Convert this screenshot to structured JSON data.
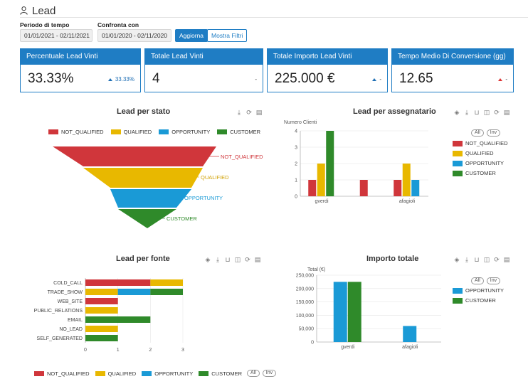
{
  "page": {
    "title": "Lead",
    "icon": "user-icon"
  },
  "filters": {
    "period_label": "Periodo di tempo",
    "period_value": "01/01/2021 - 02/11/2021",
    "compare_label": "Confronta con",
    "compare_value": "01/01/2020 - 02/11/2020",
    "refresh_button": "Aggiorna",
    "filters_button": "Mostra Filtri"
  },
  "kpis": [
    {
      "title": "Percentuale Lead Vinti",
      "value": "33.33%",
      "trend": "33.33%",
      "trend_dir": "up"
    },
    {
      "title": "Totale Lead Vinti",
      "value": "4",
      "trend": "-",
      "trend_dir": "none"
    },
    {
      "title": "Totale Importo Lead Vinti",
      "value": "225.000 €",
      "trend": "-",
      "trend_dir": "up"
    },
    {
      "title": "Tempo Medio Di Conversione (gg)",
      "value": "12.65",
      "trend": "-",
      "trend_dir": "up-red"
    }
  ],
  "colors": {
    "primary": "#1f7dc4",
    "not_qualified": "#d0363b",
    "qualified": "#e8b800",
    "opportunity": "#1a9ad6",
    "customer": "#2f8a2a"
  },
  "legend_labels": {
    "not_qualified": "NOT_QUALIFIED",
    "qualified": "QUALIFIED",
    "opportunity": "OPPORTUNITY",
    "customer": "CUSTOMER",
    "all": "All",
    "inv": "Inv"
  },
  "chart_data": [
    {
      "id": "lead-per-stato",
      "type": "funnel",
      "title": "Lead per stato",
      "categories": [
        "NOT_QUALIFIED",
        "QUALIFIED",
        "OPPORTUNITY",
        "CUSTOMER"
      ],
      "legend": "top"
    },
    {
      "id": "lead-per-assegnatario",
      "type": "bar",
      "title": "Lead per assegnatario",
      "ylabel": "Numero Clienti",
      "categories": [
        "gverdi",
        "",
        "afagioli"
      ],
      "series": [
        {
          "name": "NOT_QUALIFIED",
          "values": [
            1,
            1,
            1
          ]
        },
        {
          "name": "QUALIFIED",
          "values": [
            2,
            0,
            2
          ]
        },
        {
          "name": "OPPORTUNITY",
          "values": [
            0,
            0,
            1
          ]
        },
        {
          "name": "CUSTOMER",
          "values": [
            4,
            0,
            0
          ]
        }
      ],
      "yticks": [
        0,
        1,
        2,
        3,
        4
      ],
      "ylim": [
        0,
        4
      ],
      "legend": "right"
    },
    {
      "id": "lead-per-fonte",
      "type": "stacked-bar-horizontal",
      "title": "Lead per fonte",
      "categories": [
        "COLD_CALL",
        "TRADE_SHOW",
        "WEB_SITE",
        "PUBLIC_RELATIONS",
        "EMAIL",
        "NO_LEAD",
        "SELF_GENERATED"
      ],
      "series": [
        {
          "name": "NOT_QUALIFIED",
          "values": [
            2,
            0,
            1,
            0,
            0,
            0,
            0
          ]
        },
        {
          "name": "QUALIFIED",
          "values": [
            1,
            1,
            0,
            1,
            0,
            1,
            0
          ]
        },
        {
          "name": "OPPORTUNITY",
          "values": [
            0,
            1,
            0,
            0,
            0,
            0,
            0
          ]
        },
        {
          "name": "CUSTOMER",
          "values": [
            0,
            1,
            0,
            0,
            2,
            0,
            1
          ]
        }
      ],
      "xticks": [
        0,
        1,
        2,
        3
      ],
      "xlim": [
        0,
        3
      ],
      "legend": "bottom"
    },
    {
      "id": "importo-totale",
      "type": "bar",
      "title": "Importo totale",
      "ylabel": "Total (€)",
      "categories": [
        "gverdi",
        "afagioli"
      ],
      "series": [
        {
          "name": "OPPORTUNITY",
          "values": [
            225000,
            60000
          ]
        },
        {
          "name": "CUSTOMER",
          "values": [
            225000,
            0
          ]
        }
      ],
      "yticks": [
        "0",
        "50,000",
        "100,000",
        "150,000",
        "200,000",
        "250,000"
      ],
      "ylim": [
        0,
        250000
      ],
      "legend": "right"
    }
  ]
}
